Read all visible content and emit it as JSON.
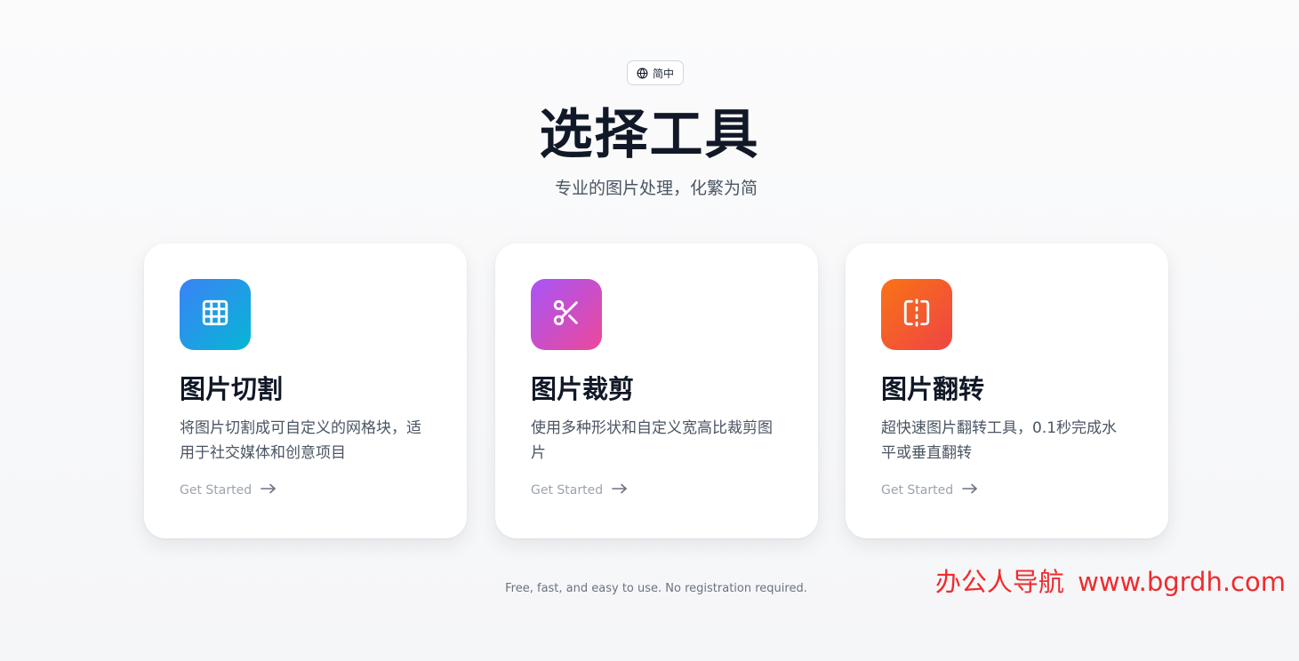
{
  "language_switcher": {
    "label": "简中",
    "icon": "globe-icon"
  },
  "header": {
    "title": "选择工具",
    "subtitle": "专业的图片处理，化繁为简"
  },
  "tools": [
    {
      "title": "图片切割",
      "description": "将图片切割成可自定义的网格块，适用于社交媒体和创意项目",
      "cta": "Get Started",
      "icon": "grid-icon",
      "colors": [
        "#3b82f6",
        "#06b6d4"
      ]
    },
    {
      "title": "图片裁剪",
      "description": "使用多种形状和自定义宽高比裁剪图片",
      "cta": "Get Started",
      "icon": "scissors-icon",
      "colors": [
        "#a855f7",
        "#ec4899"
      ]
    },
    {
      "title": "图片翻转",
      "description": "超快速图片翻转工具，0.1秒完成水平或垂直翻转",
      "cta": "Get Started",
      "icon": "flip-horizontal-icon",
      "colors": [
        "#f97316",
        "#ef4444"
      ]
    }
  ],
  "footer": {
    "note": "Free, fast, and easy to use. No registration required."
  },
  "watermark": {
    "text": "办公人导航  www.bgrdh.com",
    "color": "#ef2b2d"
  }
}
